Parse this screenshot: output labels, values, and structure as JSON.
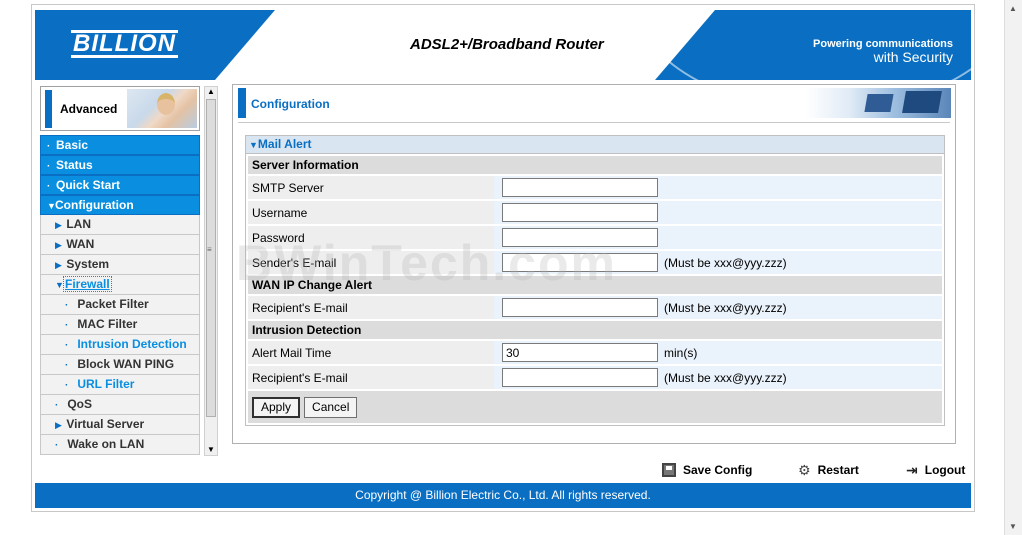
{
  "header": {
    "logo": "BILLION",
    "title": "ADSL2+/Broadband Router",
    "slogan_line1": "Powering communications",
    "slogan_line2": "with Security",
    "colors": {
      "brand_blue": "#0a6fc2",
      "menu_blue": "#0a8fe0"
    }
  },
  "sidebar": {
    "advanced_label": "Advanced",
    "menu": {
      "basic": "Basic",
      "status": "Status",
      "quick_start": "Quick Start",
      "configuration": "Configuration",
      "lan": "LAN",
      "wan": "WAN",
      "system": "System",
      "firewall": "Firewall",
      "packet_filter": "Packet Filter",
      "mac_filter": "MAC Filter",
      "intrusion_detection": "Intrusion Detection",
      "block_wan_ping": "Block WAN PING",
      "url_filter": "URL Filter",
      "qos": "QoS",
      "virtual_server": "Virtual Server",
      "wake_on_lan": "Wake on LAN"
    }
  },
  "content": {
    "title": "Configuration",
    "section_title": "Mail Alert",
    "server_info": "Server Information",
    "smtp_server": {
      "label": "SMTP Server",
      "value": ""
    },
    "username": {
      "label": "Username",
      "value": ""
    },
    "password": {
      "label": "Password",
      "value": ""
    },
    "sender_email": {
      "label": "Sender's E-mail",
      "value": "",
      "note": "(Must be xxx@yyy.zzz)"
    },
    "wan_ip_change": "WAN IP Change Alert",
    "wan_recipient": {
      "label": "Recipient's E-mail",
      "value": "",
      "note": "(Must be xxx@yyy.zzz)"
    },
    "intrusion_detection": "Intrusion Detection",
    "alert_mail_time": {
      "label": "Alert Mail Time",
      "value": "30",
      "unit": "min(s)"
    },
    "intrusion_recipient": {
      "label": "Recipient's E-mail",
      "value": "",
      "note": "(Must be xxx@yyy.zzz)"
    },
    "apply_label": "Apply",
    "cancel_label": "Cancel"
  },
  "actions": {
    "save_config": "Save Config",
    "restart": "Restart",
    "logout": "Logout"
  },
  "footer": {
    "copyright": "Copyright @ Billion Electric Co., Ltd. All rights reserved."
  },
  "watermark": "BWinTech.com"
}
